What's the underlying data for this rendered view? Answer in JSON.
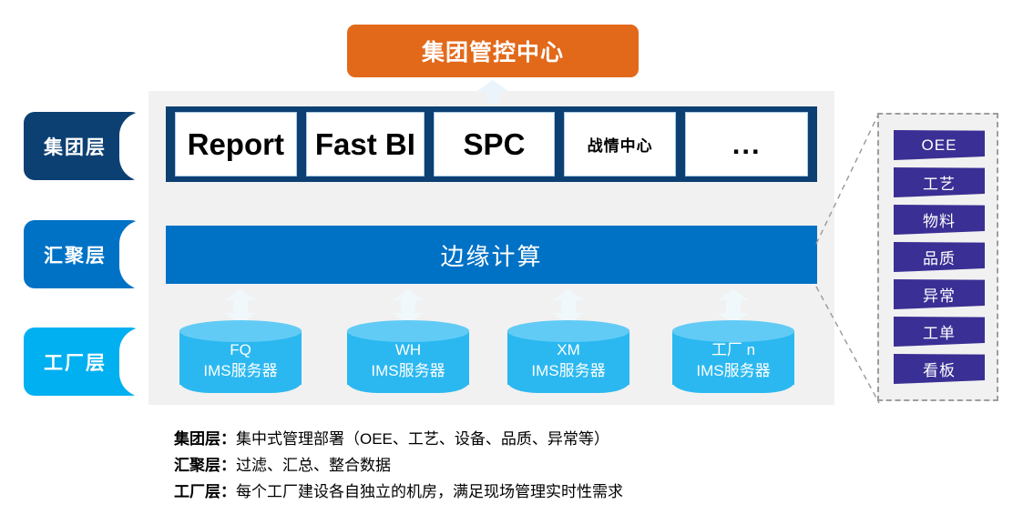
{
  "center_box": {
    "label": "集团管控中心",
    "color": "#e2691a"
  },
  "layers": [
    {
      "name": "group",
      "label": "集团层",
      "color": "#0c4072"
    },
    {
      "name": "aggregate",
      "label": "汇聚层",
      "color": "#0072c6"
    },
    {
      "name": "factory",
      "label": "工厂层",
      "color": "#00b0f0"
    }
  ],
  "app_bar": {
    "bar_color": "#0c4072",
    "items": [
      {
        "label": "Report"
      },
      {
        "label": "Fast BI"
      },
      {
        "label": "SPC"
      },
      {
        "label": "战情中心"
      },
      {
        "label": "..."
      }
    ]
  },
  "edge_bar": {
    "label": "边缘计算",
    "color": "#0072c6"
  },
  "servers": [
    {
      "site": "FQ",
      "role": "IMS服务器"
    },
    {
      "site": "WH",
      "role": "IMS服务器"
    },
    {
      "site": "XM",
      "role": "IMS服务器"
    },
    {
      "site": "工厂 n",
      "role": "IMS服务器"
    }
  ],
  "callout": {
    "chip_color": "#3a2f94",
    "modules": [
      {
        "label": "OEE"
      },
      {
        "label": "工艺"
      },
      {
        "label": "物料"
      },
      {
        "label": "品质"
      },
      {
        "label": "异常"
      },
      {
        "label": "工单"
      },
      {
        "label": "看板"
      }
    ]
  },
  "legend": [
    {
      "key": "集团层：",
      "value": "集中式管理部署（OEE、工艺、设备、品质、异常等）"
    },
    {
      "key": "汇聚层：",
      "value": "过滤、汇总、整合数据"
    },
    {
      "key": "工厂层：",
      "value": "每个工厂建设各自独立的机房，满足现场管理实时性需求"
    }
  ]
}
